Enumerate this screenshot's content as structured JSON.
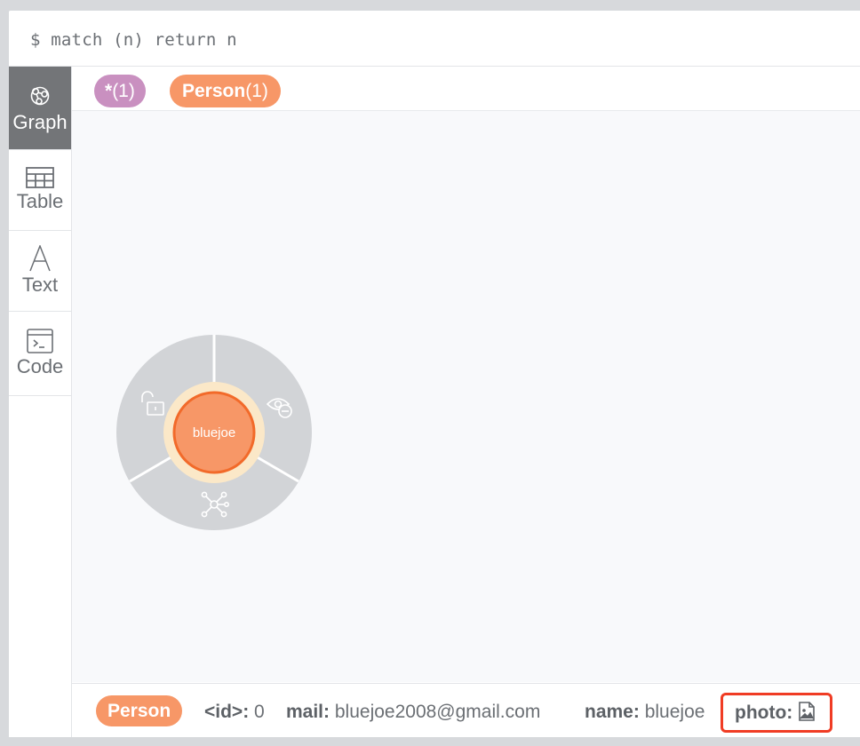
{
  "query": {
    "text": "$ match (n) return n"
  },
  "sidebar": {
    "items": [
      {
        "label": "Graph",
        "icon": "graph-icon",
        "active": true
      },
      {
        "label": "Table",
        "icon": "table-icon",
        "active": false
      },
      {
        "label": "Text",
        "icon": "text-icon",
        "active": false
      },
      {
        "label": "Code",
        "icon": "code-icon",
        "active": false
      }
    ]
  },
  "labels_bar": {
    "all": {
      "name": "*",
      "count": "(1)",
      "color": "#c990c0"
    },
    "person": {
      "name": "Person",
      "count": "(1)",
      "color": "#f79767"
    }
  },
  "graph": {
    "node": {
      "caption": "bluejoe",
      "fill": "#f79767",
      "stroke": "#f26a2a",
      "halo": "#fbe8c8"
    },
    "ring": {
      "color": "#d2d4d7",
      "actions": [
        "unlock-icon",
        "hide-icon",
        "expand-icon"
      ]
    }
  },
  "footer": {
    "label": "Person",
    "props": [
      {
        "key": "<id>:",
        "value": "0"
      },
      {
        "key": "mail:",
        "value": "bluejoe2008@gmail.com"
      },
      {
        "key": "name:",
        "value": "bluejoe"
      },
      {
        "key": "photo:",
        "value": ""
      }
    ],
    "highlight_color": "#f03c24"
  }
}
